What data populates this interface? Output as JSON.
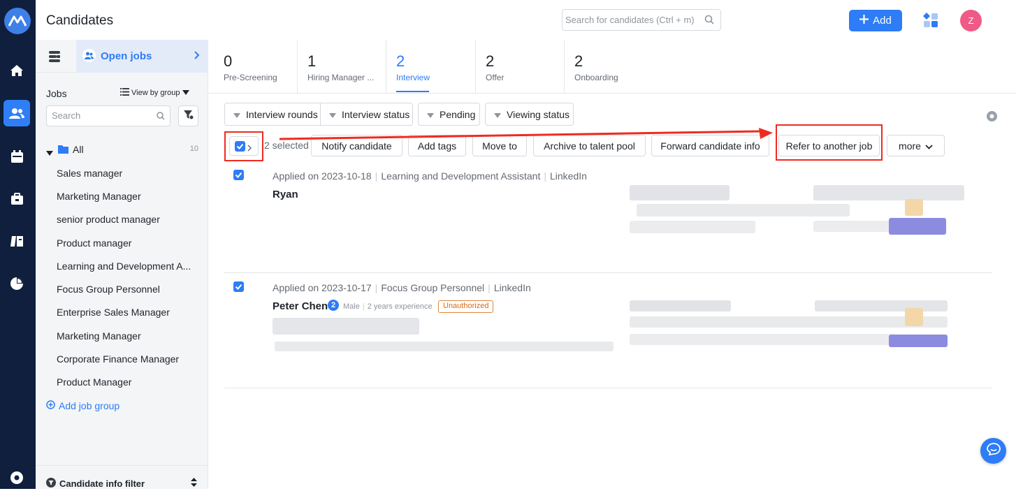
{
  "header": {
    "title": "Candidates",
    "search_placeholder": "Search for candidates (Ctrl + m)",
    "add_label": "Add",
    "avatar_initial": "Z"
  },
  "colors": {
    "accent": "#2e7cf6",
    "rail_bg": "#0f1f3d",
    "highlight_red": "#ef2b21",
    "tag_orange": "#d96b15",
    "avatar_pink": "#ef5a86"
  },
  "rail_icons": [
    "logo-icon",
    "home-icon",
    "candidates-icon",
    "calendar-icon",
    "briefcase-icon",
    "book-icon",
    "pie-chart-icon",
    "settings-icon"
  ],
  "left_panel": {
    "open_jobs_label": "Open jobs",
    "jobs_label": "Jobs",
    "view_by_group": "View by group",
    "search_placeholder": "Search",
    "all_label": "All",
    "all_count": "10",
    "jobs": [
      "Sales manager",
      "Marketing Manager",
      "senior product manager",
      "Product manager",
      "Learning and Development A...",
      "Focus Group Personnel",
      "Enterprise Sales Manager",
      "Marketing Manager",
      "Corporate Finance Manager",
      "Product Manager"
    ],
    "add_job_group": "Add job group",
    "candidate_info_filter": "Candidate info filter"
  },
  "tabs": [
    {
      "count": "0",
      "label": "Pre-Screening"
    },
    {
      "count": "1",
      "label": "Hiring Manager ..."
    },
    {
      "count": "2",
      "label": "Interview",
      "active": true
    },
    {
      "count": "2",
      "label": "Offer"
    },
    {
      "count": "2",
      "label": "Onboarding"
    }
  ],
  "filters": [
    "Interview rounds",
    "Interview status",
    "Pending",
    "Viewing status"
  ],
  "bulk": {
    "selected_text": "2 selected",
    "actions": [
      "Notify candidate",
      "Add tags",
      "Move to",
      "Archive to talent pool",
      "Forward candidate info",
      "Refer to another job"
    ],
    "more_label": "more"
  },
  "candidates": [
    {
      "applied_on": "Applied on 2023-10-18",
      "job": "Learning and Development Assistant",
      "source": "LinkedIn",
      "name": "Ryan",
      "checked": true
    },
    {
      "applied_on": "Applied on 2023-10-17",
      "job": "Focus Group Personnel",
      "source": "LinkedIn",
      "name": "Peter Chen",
      "badge": "2",
      "gender": "Male",
      "experience": "2 years experience",
      "tag": "Unauthorized",
      "checked": true
    }
  ]
}
